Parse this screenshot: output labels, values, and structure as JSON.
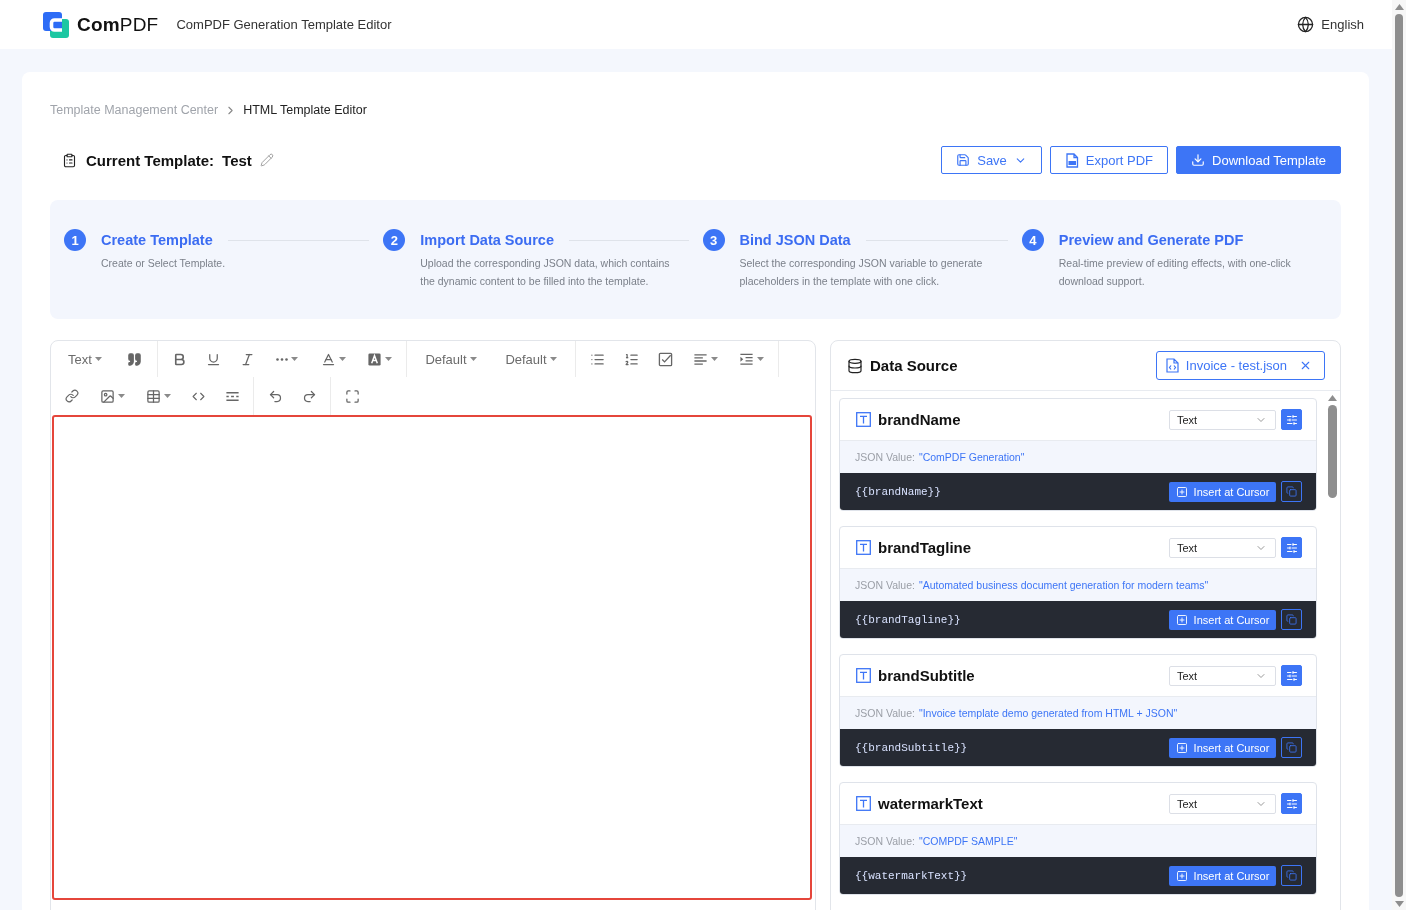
{
  "header": {
    "brand": "**Com**PDF",
    "app_title": "ComPDF Generation Template Editor",
    "language": "English"
  },
  "breadcrumb": [
    {
      "label": "Template Management Center",
      "current": false
    },
    {
      "label": "HTML Template Editor",
      "current": true
    }
  ],
  "template": {
    "label": "Current Template:",
    "name": "Test"
  },
  "actions": [
    {
      "kind": "save",
      "label": "Save",
      "primary": false
    },
    {
      "kind": "export",
      "label": "Export PDF",
      "primary": false
    },
    {
      "kind": "download",
      "label": "Download Template",
      "primary": true
    }
  ],
  "steps": [
    {
      "number": "1",
      "title": "Create Template",
      "description": "Create or Select Template."
    },
    {
      "number": "2",
      "title": "Import Data Source",
      "description": "Upload the corresponding JSON data, which contains the dynamic content to be filled into the template."
    },
    {
      "number": "3",
      "title": "Bind JSON Data",
      "description": "Select the corresponding JSON variable to generate placeholders in the template with one click."
    },
    {
      "number": "4",
      "title": "Preview and Generate PDF",
      "description": "Real-time preview of editing effects, with one-click download support."
    }
  ],
  "editor": {
    "toolbar_labels": [
      "Text",
      "Default",
      "Default"
    ]
  },
  "data_source": {
    "title": "Data Source",
    "file": "Invoice - test.json",
    "fields": [
      {
        "name": "brandName",
        "type": "Text",
        "value_label": "JSON Value:",
        "value": "\"ComPDF Generation\"",
        "placeholder": "{{brandName}}",
        "insert_label": "Insert at Cursor"
      },
      {
        "name": "brandTagline",
        "type": "Text",
        "value_label": "JSON Value:",
        "value": "\"Automated business document generation for modern teams\"",
        "placeholder": "{{brandTagline}}",
        "insert_label": "Insert at Cursor"
      },
      {
        "name": "brandSubtitle",
        "type": "Text",
        "value_label": "JSON Value:",
        "value": "\"Invoice template demo generated from HTML + JSON\"",
        "placeholder": "{{brandSubtitle}}",
        "insert_label": "Insert at Cursor"
      },
      {
        "name": "watermarkText",
        "type": "Text",
        "value_label": "JSON Value:",
        "value": "\"COMPDF SAMPLE\"",
        "placeholder": "{{watermarkText}}",
        "insert_label": "Insert at Cursor"
      }
    ]
  }
}
